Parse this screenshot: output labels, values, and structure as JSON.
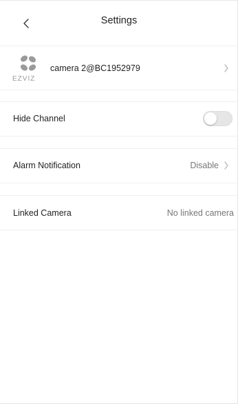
{
  "header": {
    "title": "Settings",
    "back_icon": "chevron-left-icon"
  },
  "device": {
    "brand": "EZVIZ",
    "name": "camera 2@BC1952979",
    "arrow_icon": "chevron-right-icon"
  },
  "settings": {
    "hide_channel": {
      "label": "Hide Channel",
      "enabled": false
    },
    "alarm_notification": {
      "label": "Alarm Notification",
      "value": "Disable"
    },
    "linked_camera": {
      "label": "Linked Camera",
      "value": "No linked camera"
    }
  },
  "colors": {
    "text": "#222222",
    "secondary_text": "#777777",
    "toggle_off": "#e6e6e6",
    "logo_gray": "#9a9a9a",
    "divider": "#f0f0f0"
  }
}
